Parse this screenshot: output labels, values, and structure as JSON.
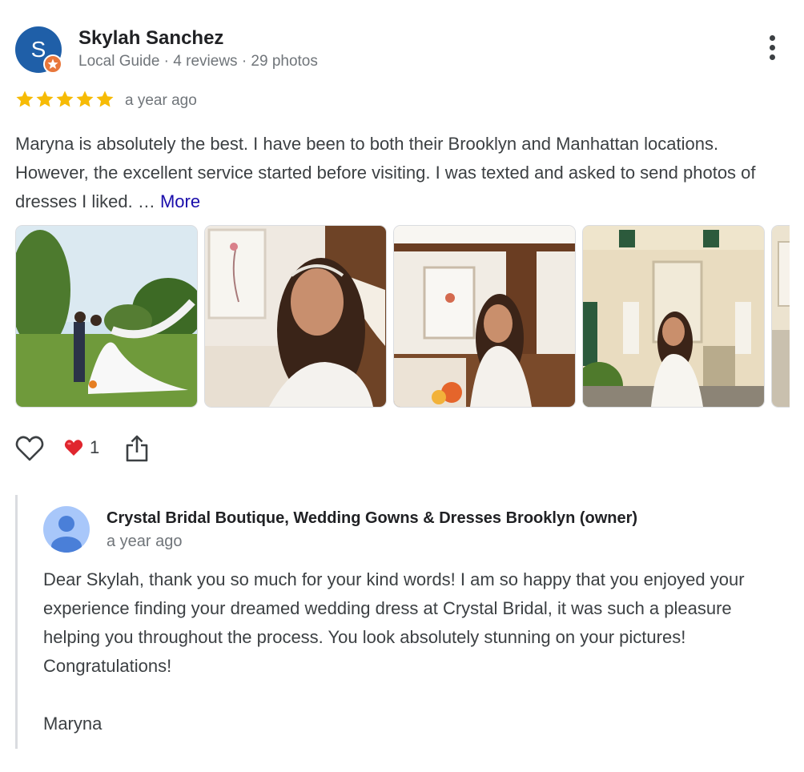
{
  "review": {
    "avatar_letter": "S",
    "reviewer_name": "Skylah Sanchez",
    "reviewer_meta": "Local Guide · 4 reviews · 29 photos",
    "rating": 5,
    "time": "a year ago",
    "text": "Maryna is absolutely the best. I have been to both their Brooklyn and Manhattan locations. However, the excellent service started before visiting. I was texted and asked to send photos of dresses I liked. … ",
    "more_label": "More",
    "photos": [
      "bride-and-groom-on-lawn-photo",
      "bride-portrait-photo",
      "bride-in-room-photo",
      "bride-at-mansion-photo"
    ],
    "actions": {
      "like_icon": "heart-outline-icon",
      "reaction_icon": "red-heart-icon",
      "reaction_count": "1",
      "share_icon": "share-icon"
    }
  },
  "owner_reply": {
    "owner_name": "Crystal Bridal Boutique, Wedding Gowns & Dresses Brooklyn (owner)",
    "time": "a year ago",
    "text": "Dear Skylah, thank you so much for your kind words! I am so happy that you enjoyed your experience finding your dreamed wedding dress at Crystal Bridal, it was such a pleasure helping you throughout the process. You look absolutely stunning on your pictures! Congratulations!\n\nMaryna"
  },
  "colors": {
    "avatar": "#1f5fa8",
    "local_guide_badge": "#e8773b",
    "star": "#f6bb06",
    "link": "#1a0dab"
  }
}
